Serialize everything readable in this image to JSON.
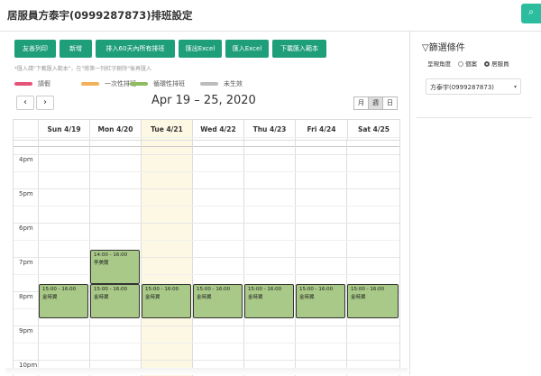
{
  "window": {
    "title": "居服員方泰宇(0999287873)排班設定"
  },
  "toolbar": {
    "buttons": [
      {
        "label": "友善列印"
      },
      {
        "label": "新增"
      },
      {
        "label": "排入60天內所有排班"
      },
      {
        "label": "匯出Excel"
      },
      {
        "label": "匯入Excel"
      },
      {
        "label": "下載匯入範本"
      }
    ],
    "hint": "*匯入請\"下載匯入範本\"，在\"將第一列紅字刪除\"後再匯入"
  },
  "legend": [
    {
      "label": "請假",
      "color": "#e6537a"
    },
    {
      "label": "一次性排班",
      "color": "#f2b25a"
    },
    {
      "label": "循環性排班",
      "color": "#8ebd5c"
    },
    {
      "label": "未生效",
      "color": "#bdbdbd"
    }
  ],
  "calendar": {
    "prev_label": "‹",
    "next_label": "›",
    "range": "Apr 19 – 25, 2020",
    "views": [
      {
        "label": "月",
        "active": false
      },
      {
        "label": "週",
        "active": true
      },
      {
        "label": "日",
        "active": false
      }
    ],
    "days": [
      "Sun 4/19",
      "Mon 4/20",
      "Tue 4/21",
      "Wed 4/22",
      "Thu 4/23",
      "Fri 4/24",
      "Sat 4/25"
    ],
    "times": [
      "4pm",
      "5pm",
      "6pm",
      "7pm",
      "8pm",
      "9pm",
      "10pm"
    ],
    "events": [
      {
        "day": 1,
        "time": "14:00 - 16:00",
        "name": "李美蘭"
      },
      {
        "day": 0,
        "time": "15:00 - 16:00",
        "name": "金時翼"
      },
      {
        "day": 1,
        "time": "15:00 - 16:00",
        "name": "金時翼"
      },
      {
        "day": 2,
        "time": "15:00 - 16:00",
        "name": "金時翼"
      },
      {
        "day": 3,
        "time": "15:00 - 16:00",
        "name": "金時翼"
      },
      {
        "day": 4,
        "time": "15:00 - 16:00",
        "name": "金時翼"
      },
      {
        "day": 5,
        "time": "15:00 - 16:00",
        "name": "金時翼"
      },
      {
        "day": 6,
        "time": "15:00 - 16:00",
        "name": "金時翼"
      }
    ]
  },
  "filter": {
    "title": "篩選條件",
    "mode_label": "呈現角度",
    "options": [
      {
        "label": "個案",
        "selected": false
      },
      {
        "label": "居服員",
        "selected": true
      }
    ],
    "selected_worker": "方泰宇(0999287873)"
  }
}
